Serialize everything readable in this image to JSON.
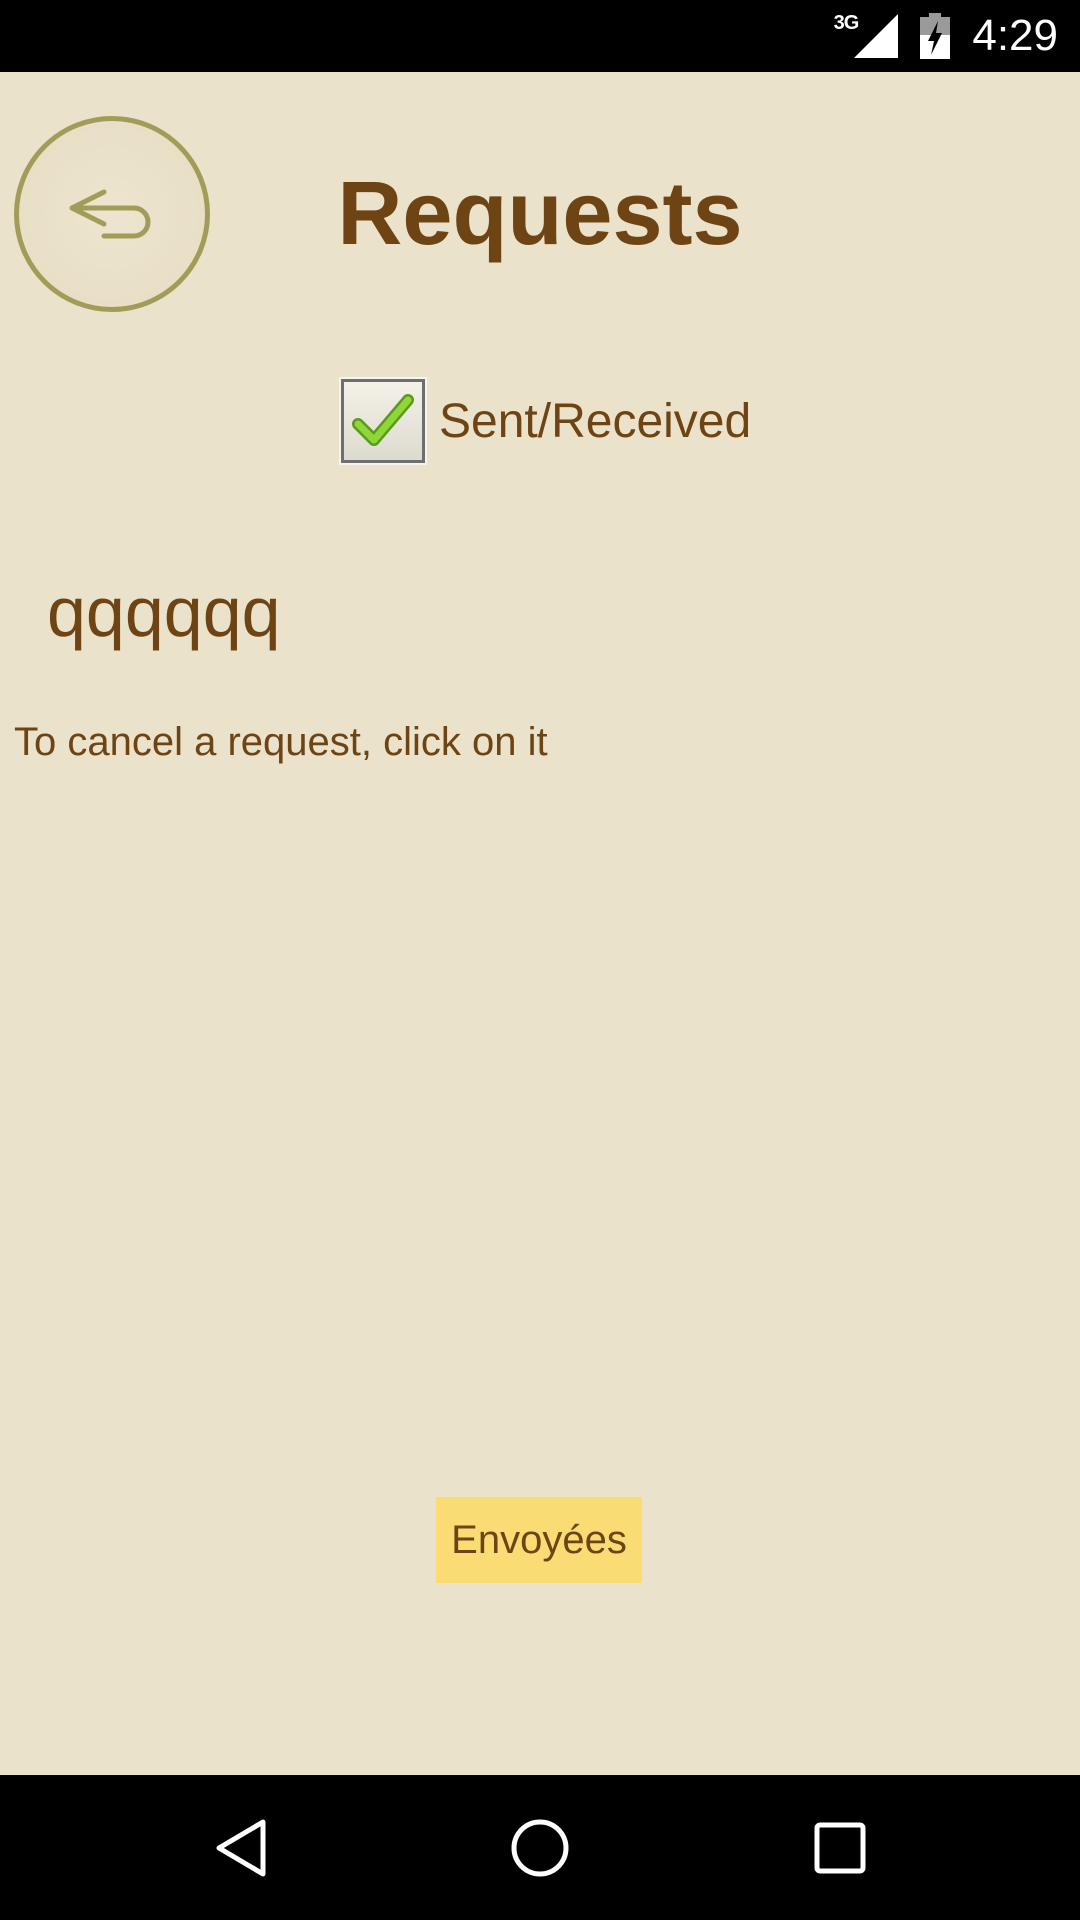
{
  "status_bar": {
    "network_type": "3G",
    "time": "4:29",
    "icons": [
      "signal-icon",
      "battery-charging-icon"
    ]
  },
  "header": {
    "back_icon": "return-arrow-icon",
    "title": "Requests"
  },
  "toggle": {
    "checked": true,
    "label": "Sent/Received"
  },
  "requests": [
    {
      "name": "qqqqqq"
    }
  ],
  "hint": "To cancel a request, click on it",
  "mode_button": {
    "label": "Envoyées"
  },
  "nav_bar": {
    "icons": [
      "back-triangle-icon",
      "home-circle-icon",
      "recents-square-icon"
    ]
  },
  "colors": {
    "background": "#ebe2cb",
    "text_brown": "#6e4414",
    "accent_yellow": "#f9dc74",
    "circle_border": "#a19c58",
    "check_green": "#7fcc2a"
  }
}
